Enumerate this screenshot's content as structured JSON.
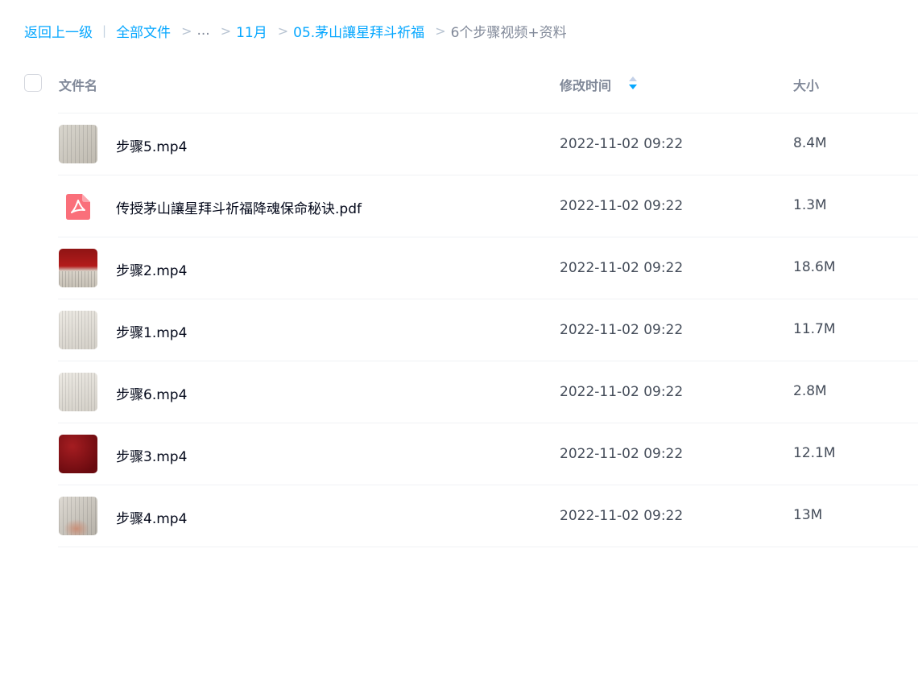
{
  "breadcrumb": {
    "back_label": "返回上一级",
    "divider": "|",
    "root_label": "全部文件",
    "separator": ">",
    "ellipsis": "...",
    "path": [
      "11月",
      "05.茅山讓星拜斗祈福"
    ],
    "current": "6个步骤视频+资料"
  },
  "table": {
    "columns": {
      "name": "文件名",
      "modified": "修改时间",
      "size": "大小"
    },
    "sort_icon": "sort-arrows-icon",
    "rows": [
      {
        "name": "步骤5.mp4",
        "modified": "2022-11-02 09:22",
        "size": "8.4M",
        "thumb": "video-thumbnail-paper"
      },
      {
        "name": "传授茅山讓星拜斗祈福降魂保命秘诀.pdf",
        "modified": "2022-11-02 09:22",
        "size": "1.3M",
        "thumb": "pdf-icon"
      },
      {
        "name": "步骤2.mp4",
        "modified": "2022-11-02 09:22",
        "size": "18.6M",
        "thumb": "video-thumbnail-red-cloth"
      },
      {
        "name": "步骤1.mp4",
        "modified": "2022-11-02 09:22",
        "size": "11.7M",
        "thumb": "video-thumbnail-paper"
      },
      {
        "name": "步骤6.mp4",
        "modified": "2022-11-02 09:22",
        "size": "2.8M",
        "thumb": "video-thumbnail-paper"
      },
      {
        "name": "步骤3.mp4",
        "modified": "2022-11-02 09:22",
        "size": "12.1M",
        "thumb": "video-thumbnail-red"
      },
      {
        "name": "步骤4.mp4",
        "modified": "2022-11-02 09:22",
        "size": "13M",
        "thumb": "video-thumbnail-hand"
      }
    ]
  },
  "colors": {
    "link": "#06a7ff",
    "muted": "#818999",
    "text": "#03081a",
    "secondary_text": "#454d5a",
    "pdf": "#fa6f7a"
  }
}
